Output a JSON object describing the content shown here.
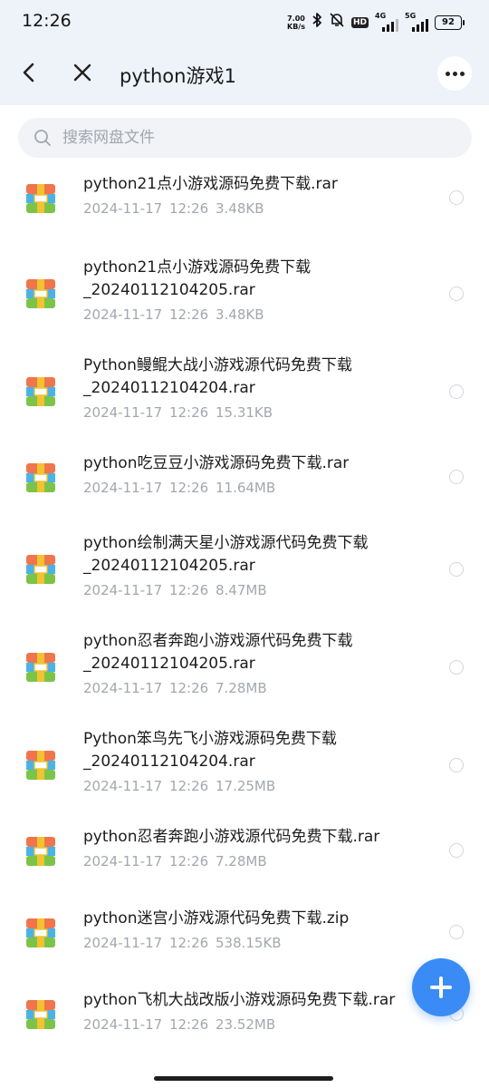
{
  "status_bar": {
    "time": "12:26",
    "net_speed_value": "7.00",
    "net_speed_unit": "KB/s",
    "hd_badge": "HD",
    "signal_1_label": "4G",
    "signal_2_label": "5G",
    "battery": "92"
  },
  "header": {
    "title": "python游戏1",
    "back_icon": "chevron-left-icon",
    "close_icon": "close-icon",
    "more_icon": "more-horizontal-icon"
  },
  "search": {
    "placeholder": "搜索网盘文件",
    "value": ""
  },
  "colors": {
    "accent": "#3a8bf5",
    "header_bg": "#eef2f9",
    "archive_top": "#f0754d",
    "archive_mid": "#4bb2e8",
    "archive_bottom": "#7cc448",
    "archive_band": "#f2c230"
  },
  "files": [
    {
      "name_lines": [
        "python21点小游戏源码免费下载.rar"
      ],
      "date": "2024-11-17",
      "time": "12:26",
      "size": "3.48KB"
    },
    {
      "name_lines": [
        "python21点小游戏源码免费下载",
        "_20240112104205.rar"
      ],
      "date": "2024-11-17",
      "time": "12:26",
      "size": "3.48KB"
    },
    {
      "name_lines": [
        "Python鳗鲲大战小游戏源代码免费下载",
        "_20240112104204.rar"
      ],
      "date": "2024-11-17",
      "time": "12:26",
      "size": "15.31KB"
    },
    {
      "name_lines": [
        "python吃豆豆小游戏源码免费下载.rar"
      ],
      "date": "2024-11-17",
      "time": "12:26",
      "size": "11.64MB"
    },
    {
      "name_lines": [
        "python绘制满天星小游戏源代码免费下载",
        "_20240112104205.rar"
      ],
      "date": "2024-11-17",
      "time": "12:26",
      "size": "8.47MB"
    },
    {
      "name_lines": [
        "python忍者奔跑小游戏源代码免费下载",
        "_20240112104205.rar"
      ],
      "date": "2024-11-17",
      "time": "12:26",
      "size": "7.28MB"
    },
    {
      "name_lines": [
        "Python笨鸟先飞小游戏源码免费下载",
        "_20240112104204.rar"
      ],
      "date": "2024-11-17",
      "time": "12:26",
      "size": "17.25MB"
    },
    {
      "name_lines": [
        "python忍者奔跑小游戏源代码免费下载.rar"
      ],
      "date": "2024-11-17",
      "time": "12:26",
      "size": "7.28MB"
    },
    {
      "name_lines": [
        "python迷宫小游戏源代码免费下载.zip"
      ],
      "date": "2024-11-17",
      "time": "12:26",
      "size": "538.15KB"
    },
    {
      "name_lines": [
        "python飞机大战改版小游戏源码免费下载.rar"
      ],
      "date": "2024-11-17",
      "time": "12:26",
      "size": "23.52MB"
    }
  ],
  "fab": {
    "icon": "plus-icon"
  }
}
